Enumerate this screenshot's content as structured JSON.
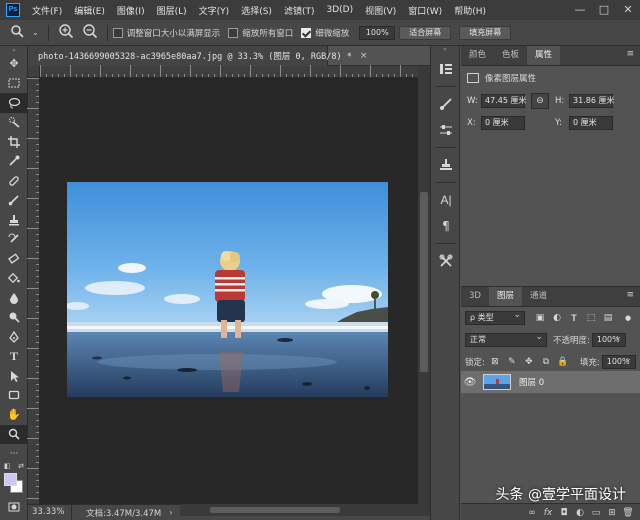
{
  "app": {
    "logo": "Ps"
  },
  "menubar": {
    "items": [
      "文件(F)",
      "编辑(E)",
      "图像(I)",
      "图层(L)",
      "文字(Y)",
      "选择(S)",
      "滤镜(T)",
      "3D(D)",
      "视图(V)",
      "窗口(W)",
      "帮助(H)"
    ],
    "window_controls": [
      "—",
      "□",
      "✕"
    ]
  },
  "optionsbar": {
    "tool_icon": "zoom-icon",
    "resize_windows_label": "调整窗口大小以满屏显示",
    "resize_windows_checked": false,
    "zoom_all_windows_label": "缩放所有窗口",
    "zoom_all_windows_checked": false,
    "scrubby_zoom_label": "细微缩放",
    "scrubby_zoom_checked": true,
    "zoom_value": "100%",
    "fit_screen_label": "适合屏幕",
    "fill_screen_label": "填充屏幕"
  },
  "document": {
    "tab_title": "photo-1436699005328-ac3965e80aa7.jpg @ 33.3% (图层 0, RGB/8) *",
    "close_glyph": "×"
  },
  "statusbar": {
    "zoom": "33.33%",
    "doc_info": "文档:3.47M/3.47M",
    "arrow": "›"
  },
  "properties_panel": {
    "tabs": [
      "颜色",
      "色板",
      "属性"
    ],
    "active_tab": "属性",
    "heading": "像素图层属性",
    "w_label": "W:",
    "w_value": "47.45 厘米",
    "h_label": "H:",
    "h_value": "31.86 厘米",
    "x_label": "X:",
    "x_value": "0 厘米",
    "y_label": "Y:",
    "y_value": "0 厘米",
    "link_glyph": "⊖"
  },
  "layers_panel": {
    "tabs": [
      "3D",
      "图层",
      "通道"
    ],
    "active_tab": "图层",
    "filter_kind": "ρ 类型",
    "blend_mode": "正常",
    "opacity_label": "不透明度:",
    "opacity_value": "100%",
    "lock_label": "锁定:",
    "fill_label": "填充:",
    "fill_value": "100%",
    "layers": [
      {
        "name": "图层 0",
        "visible": true
      }
    ],
    "footer_icons": [
      "∞",
      "fx",
      "◘",
      "◐",
      "▭",
      "⊞",
      "🗑"
    ]
  },
  "watermark": "头条 @壹学平面设计",
  "colors": {
    "foreground": "#ffffff",
    "background": "#c8c8f0",
    "ui_dark": "#282828",
    "ui_panel": "#535353"
  }
}
